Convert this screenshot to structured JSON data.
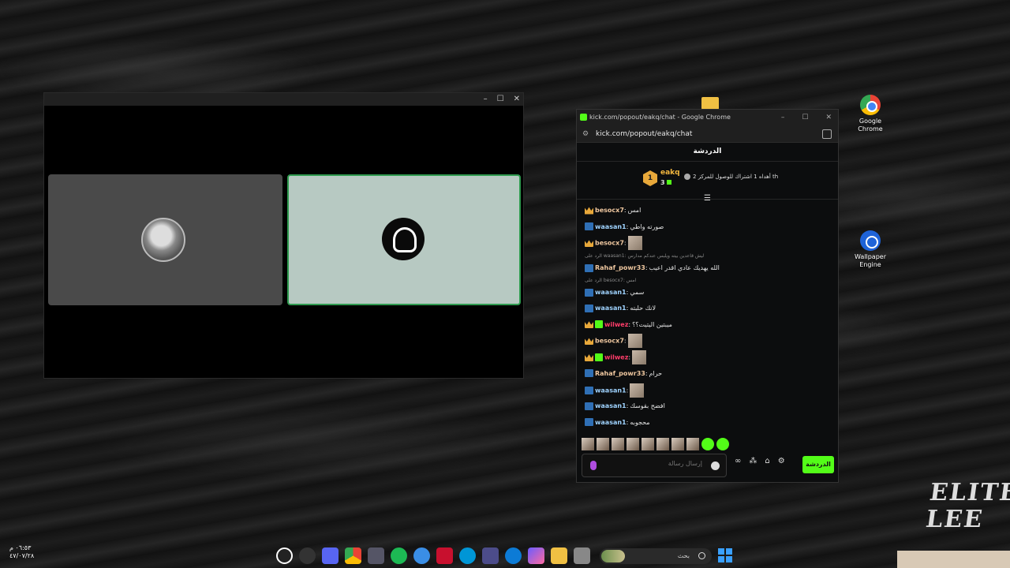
{
  "desktop": {
    "icons": [
      {
        "label": "Google Chrome",
        "icon": "chrome-icon"
      },
      {
        "label": "Wallpaper Engine",
        "icon": "wallpaper-engine-icon"
      }
    ]
  },
  "chat_window": {
    "title": "kick.com/popout/eakq/chat - Google Chrome",
    "url": "kick.com/popout/eakq/chat",
    "header": "الدردشة",
    "pinned": {
      "rank": "1",
      "username": "eakq",
      "count": "3",
      "message": "أهداه 1 اشتراك للوصول للمركز 2 th"
    },
    "messages": [
      {
        "user": "besocx7",
        "badge": "crown",
        "text": "امس",
        "emote": false
      },
      {
        "user": "waasan1",
        "badge": "wave",
        "text": "صورته واطي",
        "emote": false
      },
      {
        "user": "besocx7",
        "badge": "crown",
        "text": "",
        "emote": true
      },
      {
        "reply": "الرد على waasan1: ليش قاعدين بيته ويلبس عندكم مدارس",
        "user": "Rahaf_powr33",
        "badge": "wave",
        "text": "الله يهديك عادي اقدر اعيب",
        "emote": false
      },
      {
        "reply": "الرد على besocx7: امس",
        "user": "waasan1",
        "badge": "wave",
        "text": "سمي",
        "emote": false
      },
      {
        "user": "waasan1",
        "badge": "wave",
        "text": "لانك حلبته",
        "emote": false
      },
      {
        "user": "wilwez",
        "badge": "crown-kick",
        "text": "ميبتين اليتيت؟؟",
        "emote": false
      },
      {
        "user": "besocx7",
        "badge": "crown",
        "text": "",
        "emote": true
      },
      {
        "user": "wilwez",
        "badge": "crown-kick",
        "text": "",
        "emote": true
      },
      {
        "user": "Rahaf_powr33",
        "badge": "wave",
        "text": "حرام",
        "emote": false
      },
      {
        "user": "waasan1",
        "badge": "wave",
        "text": "",
        "emote": true
      },
      {
        "user": "waasan1",
        "badge": "wave",
        "text": "افضح بقوسك",
        "emote": false
      },
      {
        "user": "waasan1",
        "badge": "wave",
        "text": "محجوبه",
        "emote": false
      }
    ],
    "input_placeholder": "إرسال رسالة",
    "chat_button": "الدردشة"
  },
  "taskbar": {
    "clock_time": "٠٦:٥٣ م",
    "clock_date": "٤٧/٠٧/٢٨",
    "search_placeholder": "بحث"
  },
  "colors": {
    "kick_green": "#53fc18",
    "username_gold": "#f0c8a0",
    "username_red": "#ff3d6a"
  }
}
